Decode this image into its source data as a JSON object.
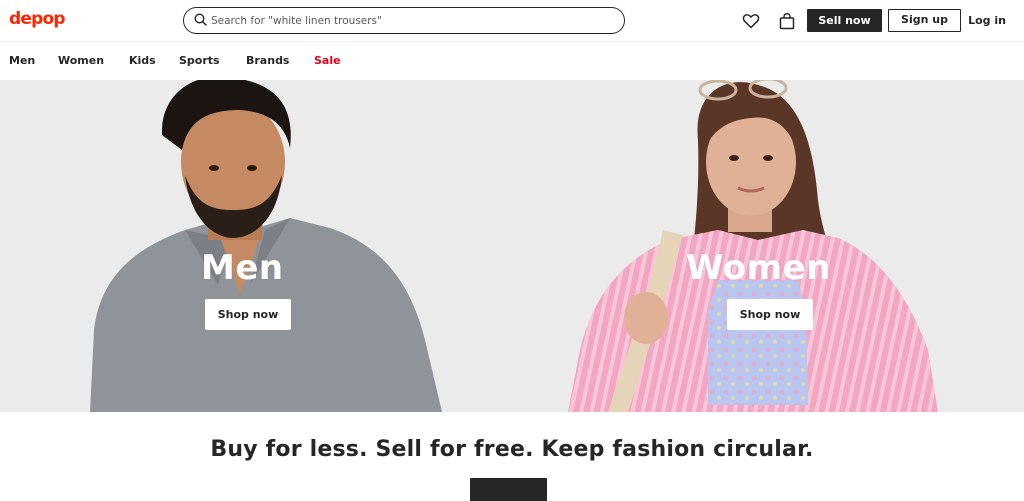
{
  "brand": {
    "logo_text": "depop",
    "logo_color": "#ff2300"
  },
  "search": {
    "placeholder": "Search for \"white linen trousers\"",
    "value": ""
  },
  "header": {
    "icons": [
      "heart-icon",
      "shopping-bag-icon"
    ],
    "sell_label": "Sell now",
    "signup_label": "Sign up",
    "login_label": "Log in"
  },
  "nav": {
    "categories": [
      {
        "label": "Men"
      },
      {
        "label": "Women"
      },
      {
        "label": "Kids"
      },
      {
        "label": "Sports"
      },
      {
        "label": "Brands"
      },
      {
        "label": "Sale",
        "color": "#e1001e"
      }
    ]
  },
  "hero": {
    "panels": [
      {
        "title": "Men",
        "button": "Shop now"
      },
      {
        "title": "Women",
        "button": "Shop now"
      }
    ]
  },
  "tagline": "Buy for less. Sell for free. Keep fashion circular.",
  "colors": {
    "dark": "#262626",
    "hero_bg": "#ebebeb",
    "sale": "#e1001e"
  }
}
